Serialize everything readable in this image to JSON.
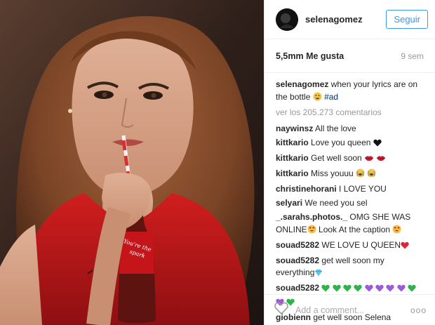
{
  "post": {
    "username": "selenagomez",
    "follow_label": "Seguir",
    "likes": "5,5mm Me gusta",
    "time_ago": "9 sem",
    "caption_user": "selenagomez",
    "caption_text": "when your lyrics are on the bottle",
    "hashtag": "#ad",
    "view_more": "ver los 205.273 comentarios",
    "add_comment_placeholder": "Add a comment...",
    "more_options": "ooo",
    "bottle_text": "You're the spark"
  },
  "comments": [
    {
      "user": "naywinsz",
      "text": "All the love",
      "emoji": []
    },
    {
      "user": "kittkario",
      "text": "Love you queen",
      "emoji": [
        "heart-black"
      ]
    },
    {
      "user": "kittkario",
      "text": "Get well soon",
      "emoji": [
        "lips",
        "lips"
      ]
    },
    {
      "user": "kittkario",
      "text": "Miss youuu",
      "emoji": [
        "crying-face",
        "crying-face"
      ]
    },
    {
      "user": "christinehorani",
      "text": "I LOVE YOU",
      "emoji": []
    },
    {
      "user": "selyari",
      "text": "We need you sel",
      "emoji": []
    },
    {
      "user": "_.sarahs.photos._",
      "text": "OMG SHE WAS ONLINE",
      "text2": "Look At the caption",
      "emoji": [
        "heart-eyes"
      ],
      "emoji2": [
        "heart-eyes"
      ]
    },
    {
      "user": "souad5282",
      "text": "WE LOVE U QUEEN",
      "emoji": [
        "heart-red"
      ]
    },
    {
      "user": "souad5282",
      "text": "get well soon my everything",
      "emoji": [
        "diamond"
      ]
    },
    {
      "user": "souad5282",
      "text": "",
      "emoji": [
        "heart-green",
        "heart-green",
        "heart-green",
        "heart-green",
        "heart-purple",
        "heart-purple",
        "heart-purple",
        "heart-purple",
        "heart-green",
        "heart-purple",
        "heart-green"
      ]
    },
    {
      "user": "giobienn",
      "text": "get well soon Selena",
      "emoji": []
    }
  ],
  "colors": {
    "link_blue": "#3897f0",
    "text_dark": "#262626",
    "text_muted": "#999999"
  }
}
